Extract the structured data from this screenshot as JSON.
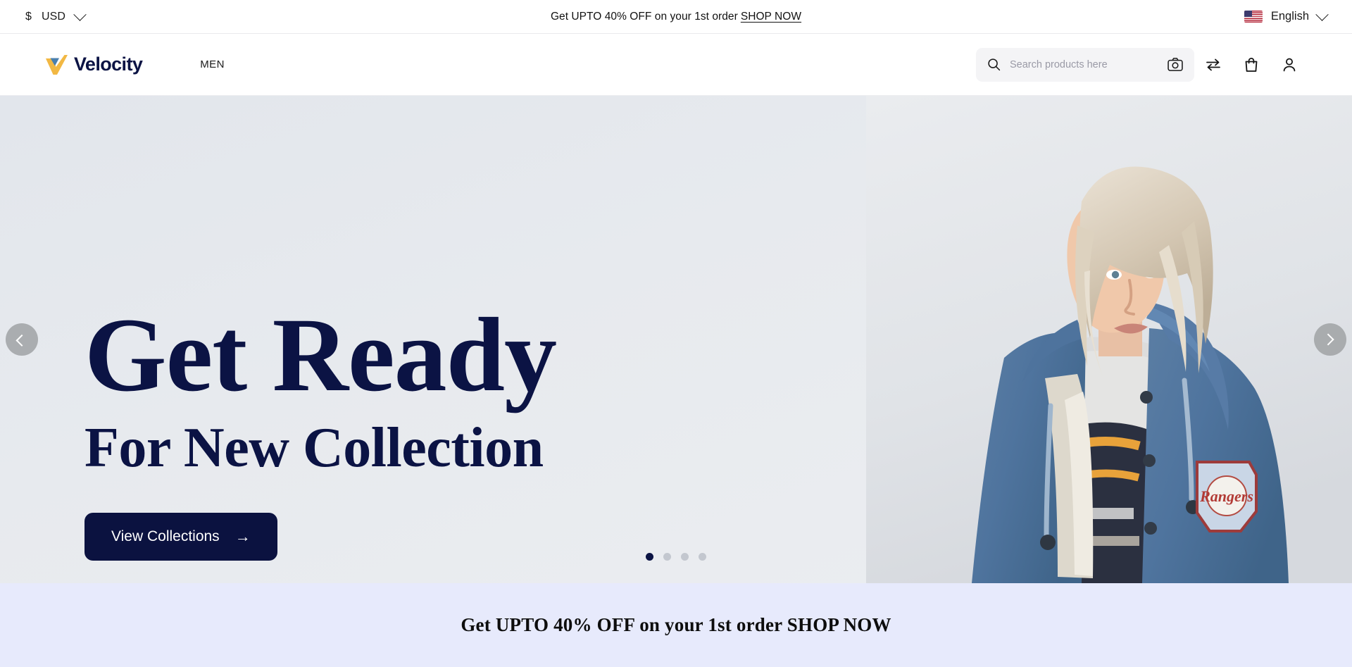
{
  "topbar": {
    "currency": {
      "symbol": "$",
      "code": "USD",
      "icon": "chevron-down-icon"
    },
    "promo": {
      "text": "Get UPTO 40% OFF on your 1st order",
      "link_label": "SHOP NOW"
    },
    "language": {
      "label": "English",
      "flag": "us-flag-icon",
      "icon": "chevron-down-icon"
    }
  },
  "header": {
    "brand": "Velocity",
    "nav": [
      {
        "label": "MEN"
      }
    ],
    "search": {
      "placeholder": "Search products here",
      "value": "",
      "search_icon": "search-icon",
      "camera_icon": "camera-icon"
    },
    "actions": [
      {
        "name": "compare",
        "icon": "compare-arrows-icon"
      },
      {
        "name": "cart",
        "icon": "shopping-bag-icon"
      },
      {
        "name": "account",
        "icon": "user-icon"
      }
    ]
  },
  "hero": {
    "title": "Get Ready",
    "subtitle": "For New Collection",
    "cta_label": "View Collections",
    "cta_arrow": "→",
    "prev_label": "Previous slide",
    "next_label": "Next slide",
    "slides": [
      {
        "active": true
      },
      {
        "active": false
      },
      {
        "active": false
      },
      {
        "active": false
      }
    ]
  },
  "bottom_banner": {
    "text": "Get UPTO 40% OFF on your 1st order SHOP NOW"
  },
  "colors": {
    "navy": "#0b1344",
    "gold": "#f2b843",
    "steel_blue": "#4a7fae",
    "banner_bg": "#e7eafc",
    "hero_bg": "#e6e9ed",
    "search_bg": "#f4f4f6"
  }
}
